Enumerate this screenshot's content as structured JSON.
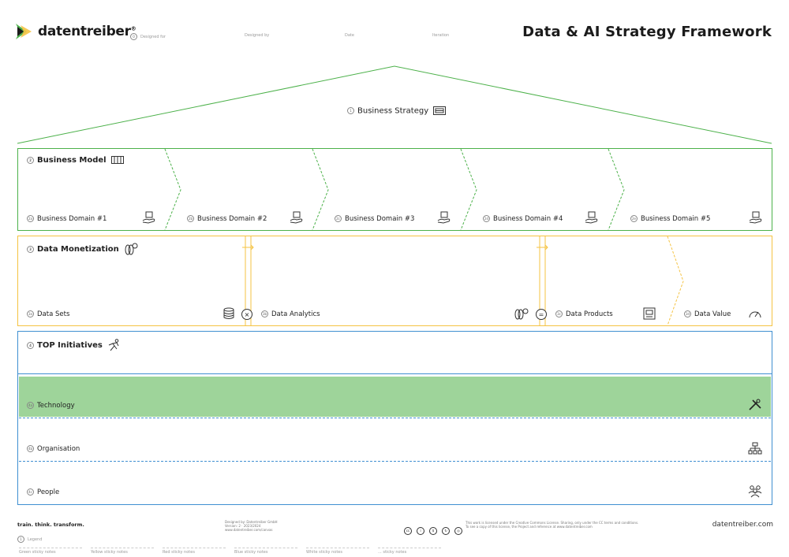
{
  "header": {
    "logo_text": "datentreiber",
    "logo_mark": "®",
    "designed_for": "Designed for",
    "designed_by": "Designed by",
    "date": "Date",
    "iteration": "Iteration",
    "title": "Data & AI Strategy Framework"
  },
  "strategy": {
    "label": "Business Strategy",
    "number": "1"
  },
  "business_model": {
    "title": "Business Model",
    "number": "2",
    "domains": [
      {
        "label": "Business Domain #1",
        "number": "2a"
      },
      {
        "label": "Business Domain #2",
        "number": "2b"
      },
      {
        "label": "Business Domain #3",
        "number": "2c"
      },
      {
        "label": "Business Domain #4",
        "number": "2d"
      },
      {
        "label": "Business Domain #5",
        "number": "2e"
      }
    ]
  },
  "monetization": {
    "title": "Data Monetization",
    "number": "3",
    "data_sets": {
      "label": "Data Sets",
      "number": "3a"
    },
    "times_op": "×",
    "data_analytics": {
      "label": "Data Analytics",
      "number": "3b"
    },
    "equals_op": "=",
    "data_products": {
      "label": "Data Products",
      "number": "3c"
    },
    "data_value": {
      "label": "Data Value",
      "number": "3d"
    }
  },
  "initiatives": {
    "title": "TOP Initiatives",
    "number": "4",
    "technology": {
      "label": "Technology",
      "number": "4a"
    },
    "organisation": {
      "label": "Organisation",
      "number": "4b"
    },
    "people": {
      "label": "People",
      "number": "4c"
    }
  },
  "footer": {
    "tagline": "train. think. transform.",
    "credits_1": "Designed by: Datentreiber GmbH",
    "credits_2": "Version: 2 · 2023/2024",
    "credits_3": "www.datentreiber.com/canvas",
    "license_1": "This work is licensed under the Creative Commons License. Sharing, only under the CC terms and conditions.",
    "license_2": "To see a copy of this license, the Project and reference at www.datentreiber.com",
    "url": "datentreiber.com",
    "legend_label": "Legend",
    "legend_number": "1",
    "legend": [
      "Green sticky notes",
      "Yellow sticky notes",
      "Red sticky notes",
      "Blue sticky notes",
      "White sticky notes",
      "... sticky notes"
    ]
  },
  "colors": {
    "green": "#4cb14a",
    "yellow": "#f5c342",
    "blue": "#3f8fd1",
    "tech_fill": "#9ed49a"
  }
}
